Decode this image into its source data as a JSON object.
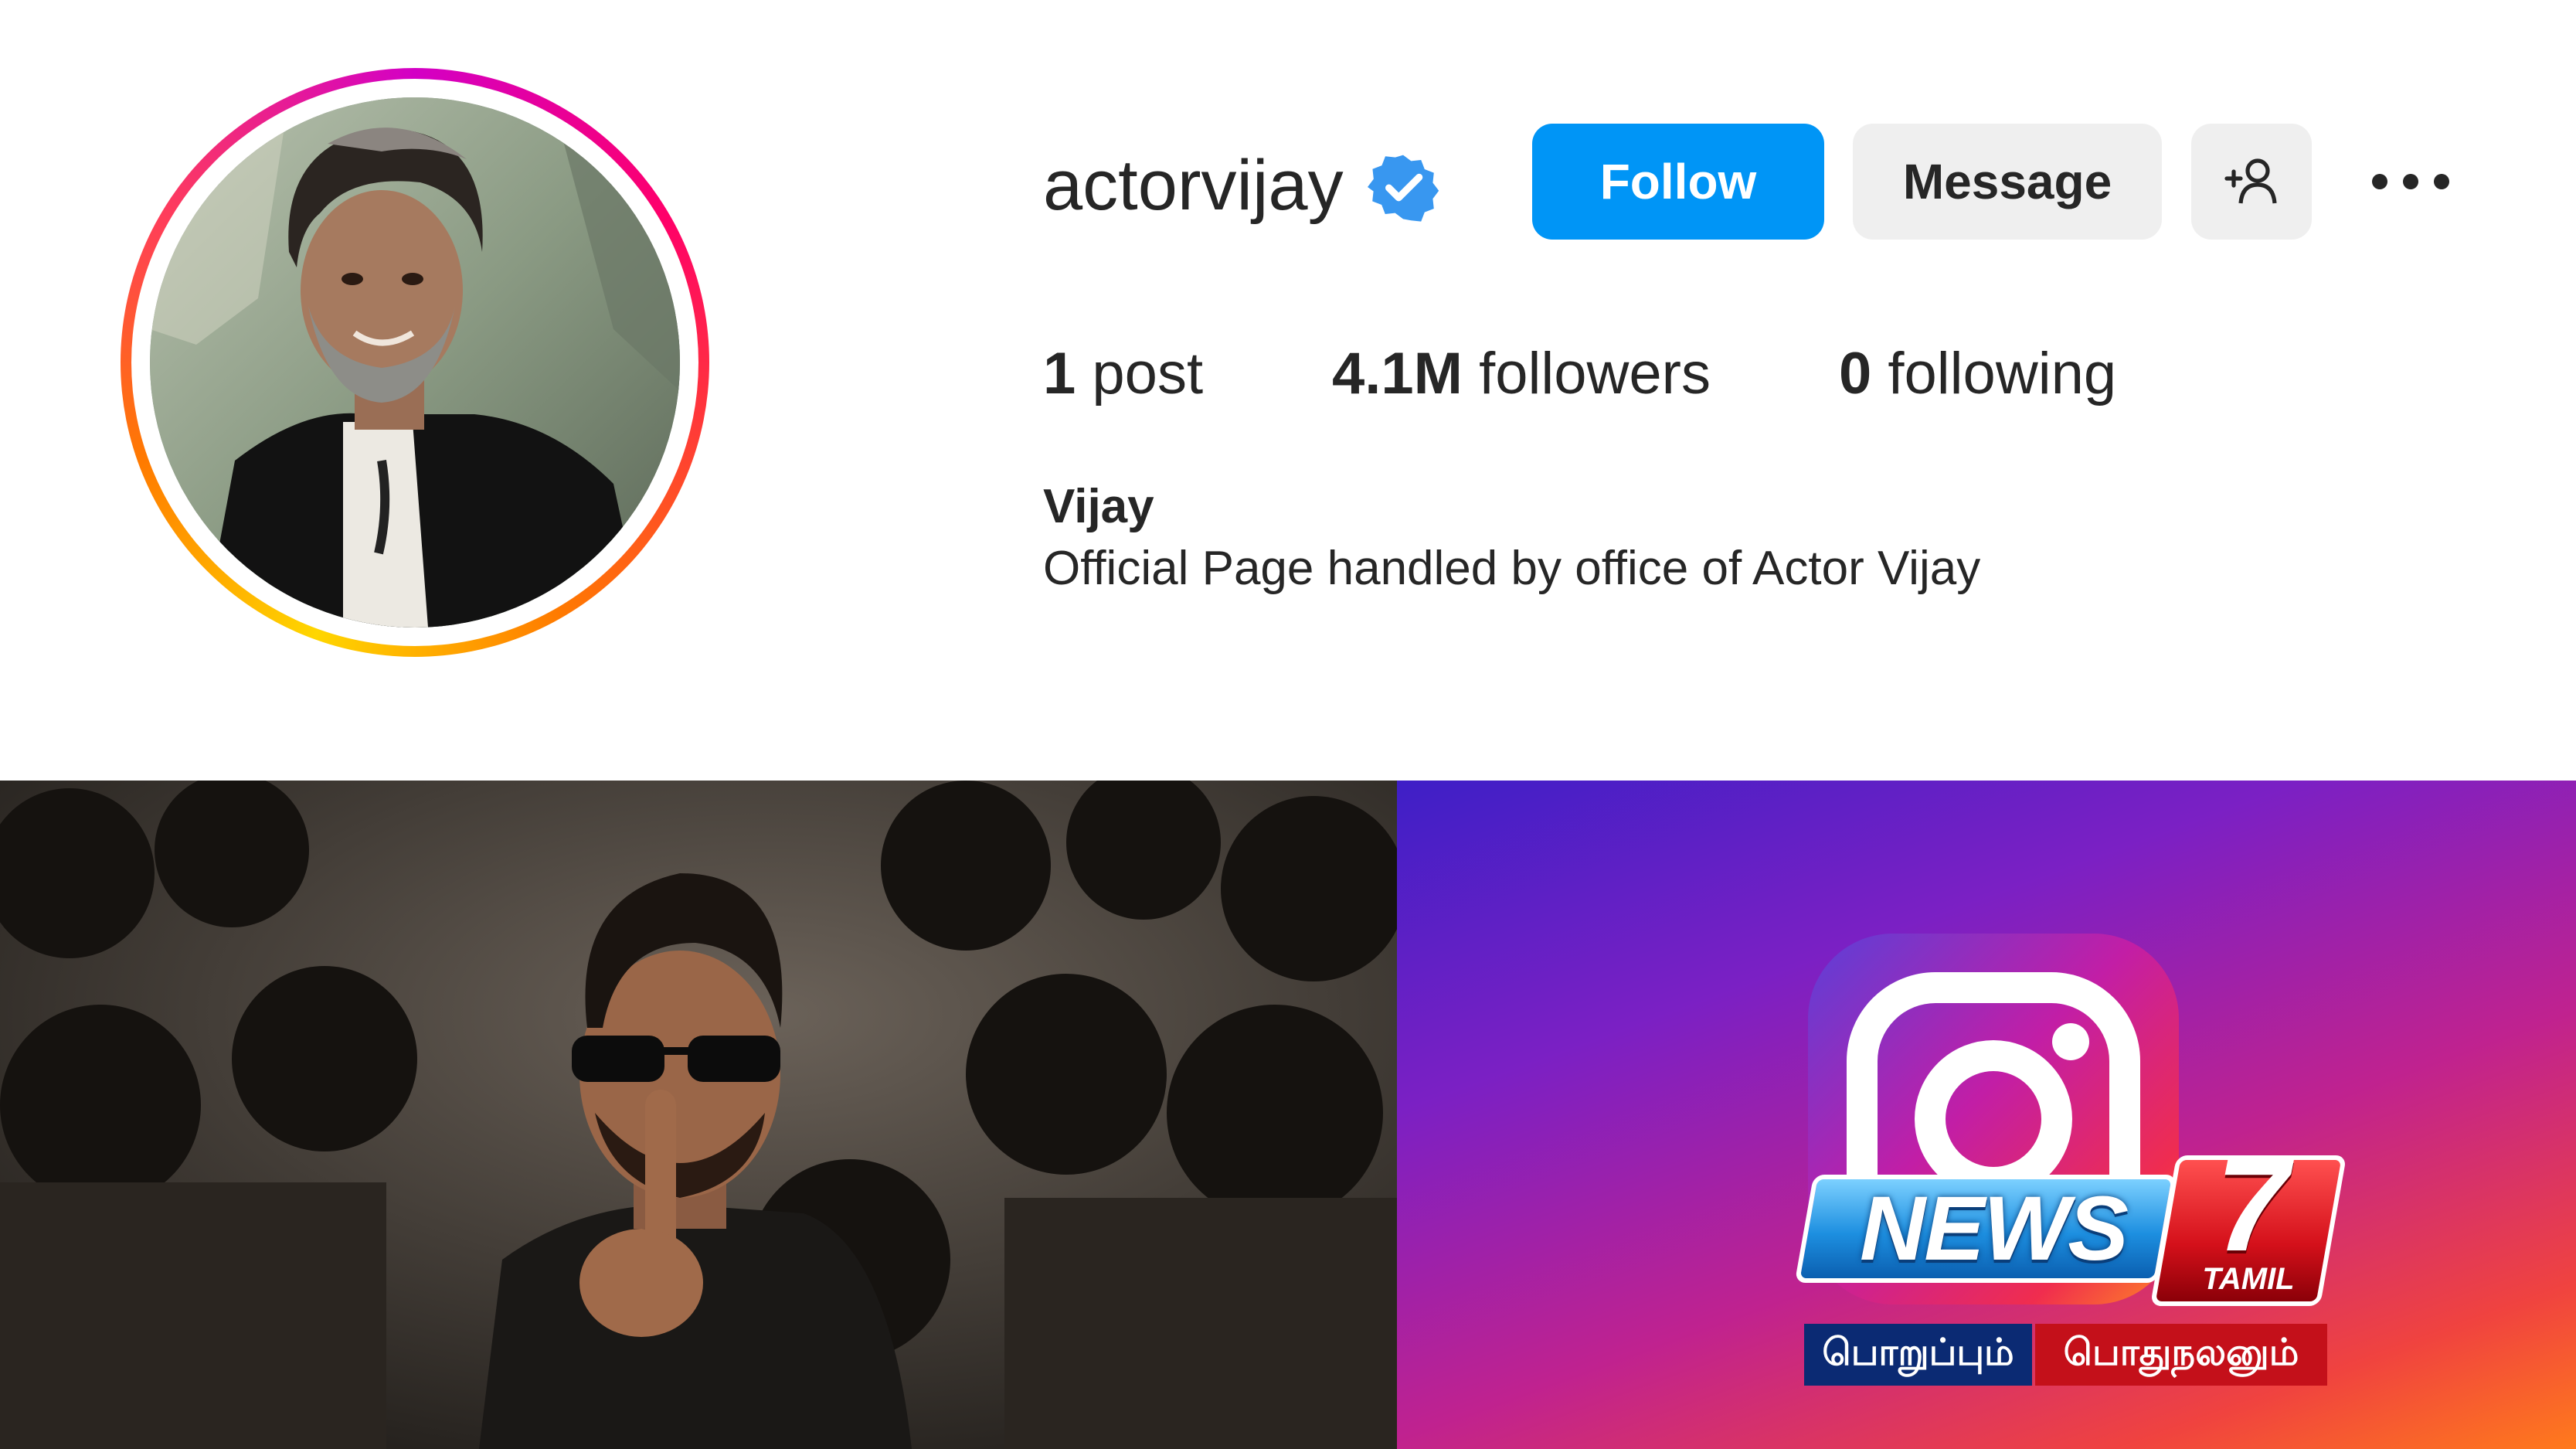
{
  "profile": {
    "username": "actorvijay",
    "verified_icon": "verified-badge-icon",
    "follow_label": "Follow",
    "message_label": "Message",
    "add_user_icon": "add-user-icon",
    "more_icon": "more-options-icon",
    "stats": {
      "posts_count": "1",
      "posts_label": "post",
      "followers_count": "4.1M",
      "followers_label": "followers",
      "following_count": "0",
      "following_label": "following"
    },
    "full_name": "Vijay",
    "bio": "Official Page handled by office of Actor Vijay"
  },
  "promo": {
    "instagram_icon": "instagram-logo-icon",
    "brand_word": "NEWS",
    "brand_digit": "7",
    "brand_sub": "TAMIL",
    "tagline_left": "பொறுப்பும்",
    "tagline_right": "பொதுநலனும்"
  },
  "colors": {
    "follow_blue": "#0095f6",
    "button_gray": "#efefef",
    "verified_blue": "#3897f0",
    "text": "#262626"
  }
}
